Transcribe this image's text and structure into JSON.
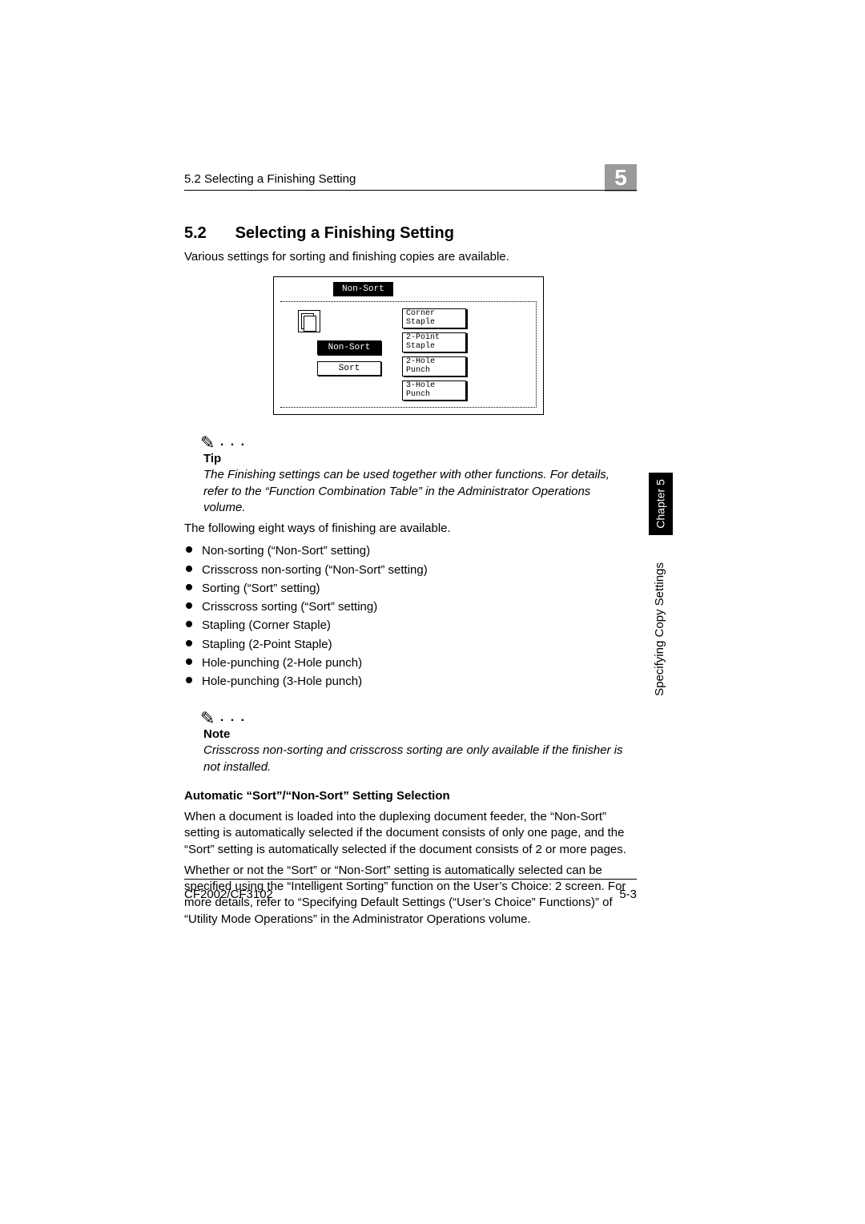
{
  "header": {
    "running": "5.2 Selecting a Finishing Setting",
    "chapnum": "5"
  },
  "title": {
    "num": "5.2",
    "text": "Selecting a Finishing Setting"
  },
  "intro": "Various settings for sorting and finishing copies are available.",
  "figure": {
    "tab": "Non-Sort",
    "left": {
      "nonsort": "Non-Sort",
      "sort": "Sort"
    },
    "right": {
      "corner": "Corner\nStaple",
      "twopoint": "2-Point\nStaple",
      "hole2": "2-Hole\nPunch",
      "hole3": "3-Hole\nPunch"
    }
  },
  "tip": {
    "title": "Tip",
    "body": "The Finishing settings can be used together with other functions. For details, refer to the “Function Combination Table” in the Administrator Operations volume."
  },
  "lead": "The following eight ways of finishing are available.",
  "items": [
    "Non-sorting (“Non-Sort” setting)",
    "Crisscross non-sorting (“Non-Sort” setting)",
    "Sorting (“Sort” setting)",
    "Crisscross sorting (“Sort” setting)",
    "Stapling (Corner Staple)",
    "Stapling (2-Point Staple)",
    "Hole-punching (2-Hole punch)",
    "Hole-punching (3-Hole punch)"
  ],
  "note": {
    "title": "Note",
    "body": "Crisscross non-sorting and crisscross sorting are only available if the finisher is not installed."
  },
  "auto": {
    "heading": "Automatic “Sort”/“Non-Sort” Setting Selection",
    "p1": "When a document is loaded into the duplexing document feeder, the “Non-Sort” setting is automatically selected if the document consists of only one page, and the “Sort” setting is automatically selected if the document consists of 2 or more pages.",
    "p2": "Whether or not the “Sort” or “Non-Sort” setting is automatically selected can be specified using the “Intelligent Sorting” function on the User’s Choice: 2 screen. For more details, refer to “Specifying Default Settings (“User’s Choice” Functions)” of “Utility Mode Operations” in the Administrator Operations volume."
  },
  "side": {
    "chapter": "Chapter 5",
    "label": "Specifying Copy Settings"
  },
  "footer": {
    "model": "CF2002/CF3102",
    "page": "5-3"
  }
}
